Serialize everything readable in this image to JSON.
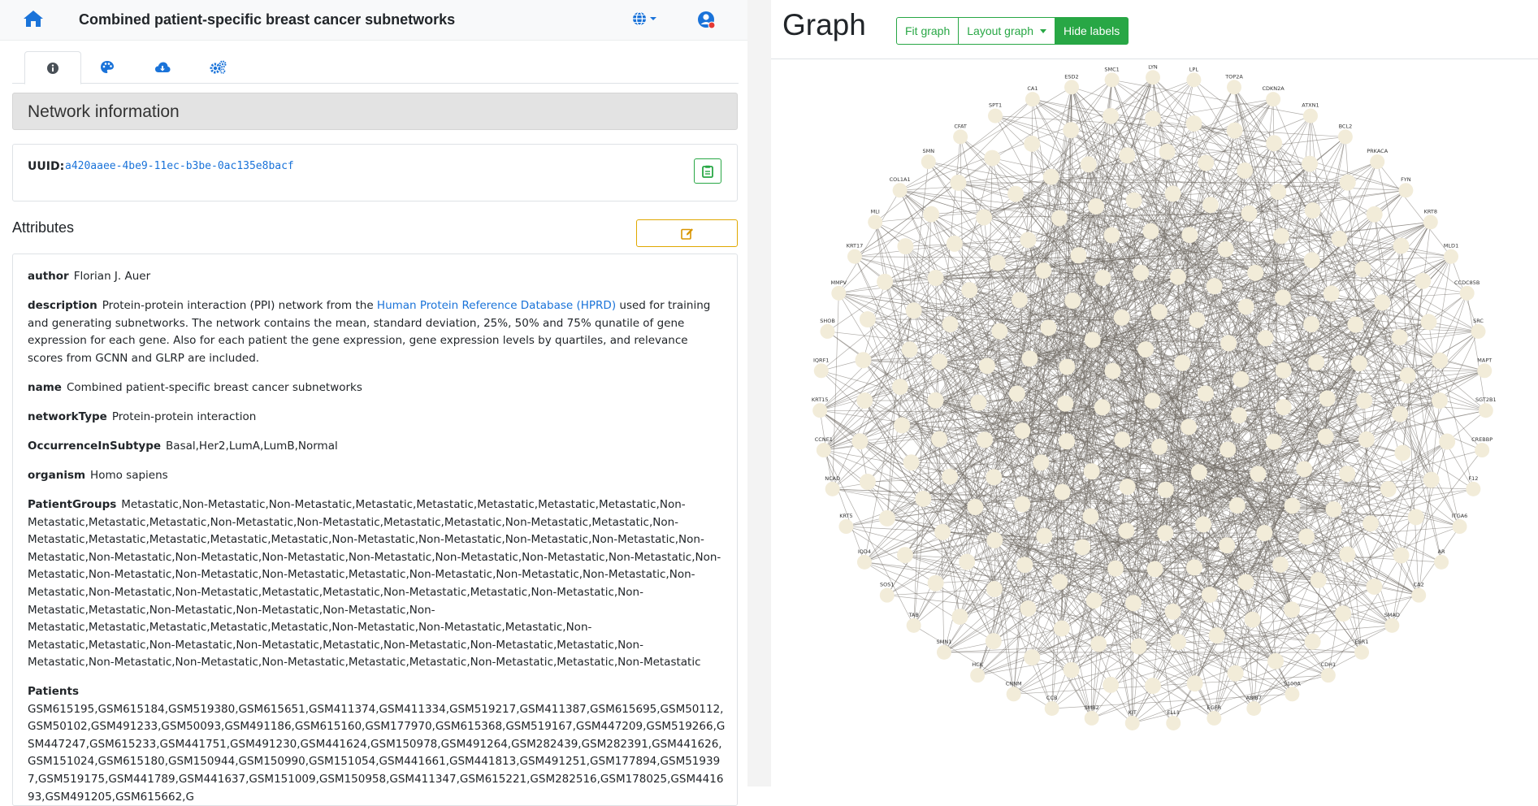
{
  "header": {
    "title": "Combined patient-specific breast cancer subnetworks",
    "home_icon": "home-icon",
    "language_icon": "globe-icon",
    "user_icon": "user-icon"
  },
  "tabs": [
    {
      "icon": "info-icon",
      "active": true
    },
    {
      "icon": "palette-icon",
      "active": false
    },
    {
      "icon": "cloud-download-icon",
      "active": false
    },
    {
      "icon": "cogs-icon",
      "active": false
    }
  ],
  "network_info": {
    "heading": "Network information",
    "uuid_label": "UUID:",
    "uuid_value": "a420aaee-4be9-11ec-b3be-0ac135e8bacf"
  },
  "attributes": {
    "heading": "Attributes",
    "author_key": "author",
    "author_value": "Florian J. Auer",
    "description_key": "description",
    "description_pre": "Protein-protein interaction (PPI) network from the",
    "description_link": "Human Protein Reference Database (HPRD)",
    "description_post": "used for training and generating subnetworks. The network contains the mean, standard deviation, 25%, 50% and 75% qunatile of gene expression for each gene. Also for each patient the gene expression, gene expression levels by quartiles, and relevance scores from GCNN and GLRP are included.",
    "name_key": "name",
    "name_value": "Combined patient-specific breast cancer subnetworks",
    "networktype_key": "networkType",
    "networktype_value": "Protein-protein interaction",
    "subtype_key": "OccurrenceInSubtype",
    "subtype_value": "Basal,Her2,LumA,LumB,Normal",
    "organism_key": "organism",
    "organism_value": "Homo sapiens",
    "patientgroups_key": "PatientGroups",
    "patientgroups_value": "Metastatic,Non-Metastatic,Non-Metastatic,Metastatic,Metastatic,Metastatic,Metastatic,Metastatic,Non-Metastatic,Metastatic,Metastatic,Non-Metastatic,Non-Metastatic,Metastatic,Metastatic,Non-Metastatic,Metastatic,Non-Metastatic,Metastatic,Metastatic,Metastatic,Metastatic,Non-Metastatic,Non-Metastatic,Non-Metastatic,Non-Metastatic,Non-Metastatic,Non-Metastatic,Non-Metastatic,Non-Metastatic,Non-Metastatic,Non-Metastatic,Non-Metastatic,Non-Metastatic,Non-Metastatic,Non-Metastatic,Non-Metastatic,Non-Metastatic,Metastatic,Non-Metastatic,Non-Metastatic,Non-Metastatic,Non-Metastatic,Non-Metastatic,Non-Metastatic,Metastatic,Metastatic,Non-Metastatic,Metastatic,Non-Metastatic,Non-Metastatic,Metastatic,Non-Metastatic,Non-Metastatic,Non-Metastatic,Non-Metastatic,Metastatic,Metastatic,Metastatic,Metastatic,Non-Metastatic,Non-Metastatic,Metastatic,Non-Metastatic,Metastatic,Non-Metastatic,Non-Metastatic,Metastatic,Non-Metastatic,Non-Metastatic,Metastatic,Non-Metastatic,Non-Metastatic,Non-Metastatic,Non-Metastatic,Metastatic,Metastatic,Non-Metastatic,Metastatic,Non-Metastatic",
    "patients_key": "Patients",
    "patients_value": "GSM615195,GSM615184,GSM519380,GSM615651,GSM411374,GSM411334,GSM519217,GSM411387,GSM615695,GSM50112,GSM50102,GSM491233,GSM50093,GSM491186,GSM615160,GSM177970,GSM615368,GSM519167,GSM447209,GSM519266,GSM447247,GSM615233,GSM441751,GSM491230,GSM441624,GSM150978,GSM491264,GSM282439,GSM282391,GSM441626,GSM151024,GSM615180,GSM150944,GSM150990,GSM151054,GSM441661,GSM441813,GSM491251,GSM177894,GSM519397,GSM519175,GSM441789,GSM441637,GSM151009,GSM150958,GSM411347,GSM615221,GSM282516,GSM178025,GSM441693,GSM491205,GSM615662,G"
  },
  "graph": {
    "title": "Graph",
    "fit_label": "Fit graph",
    "layout_label": "Layout graph",
    "labels_label": "Hide labels",
    "node_color": "#f2ecd9",
    "edge_color": "#6f6a63",
    "peripheral_labels": [
      "LYN",
      "LPL",
      "TOP2A",
      "CDKN2A",
      "ATXN1",
      "BCL2",
      "PRKACA",
      "FYN",
      "KRT8",
      "MLD1",
      "CCDC85B",
      "SRC",
      "MAPT",
      "SGT2B1",
      "CREBBP",
      "F12",
      "ITGA6",
      "AR",
      "CA2",
      "SMAD",
      "ESR1",
      "CDH1",
      "S100A",
      "ABIB7",
      "EGFR",
      "ELL1",
      "KIT",
      "SMB2",
      "CCB",
      "CNNM",
      "HCK",
      "SMN1",
      "TAB",
      "SOS1",
      "IQD4",
      "KRT5",
      "NCAD",
      "CCNE1",
      "KRT15",
      "IQRF1",
      "SHOB",
      "MMPV",
      "KRT17",
      "MLI",
      "COL1A1",
      "SMN",
      "CFAT",
      "SPT1",
      "CA1",
      "ESD2",
      "SMC1"
    ]
  }
}
